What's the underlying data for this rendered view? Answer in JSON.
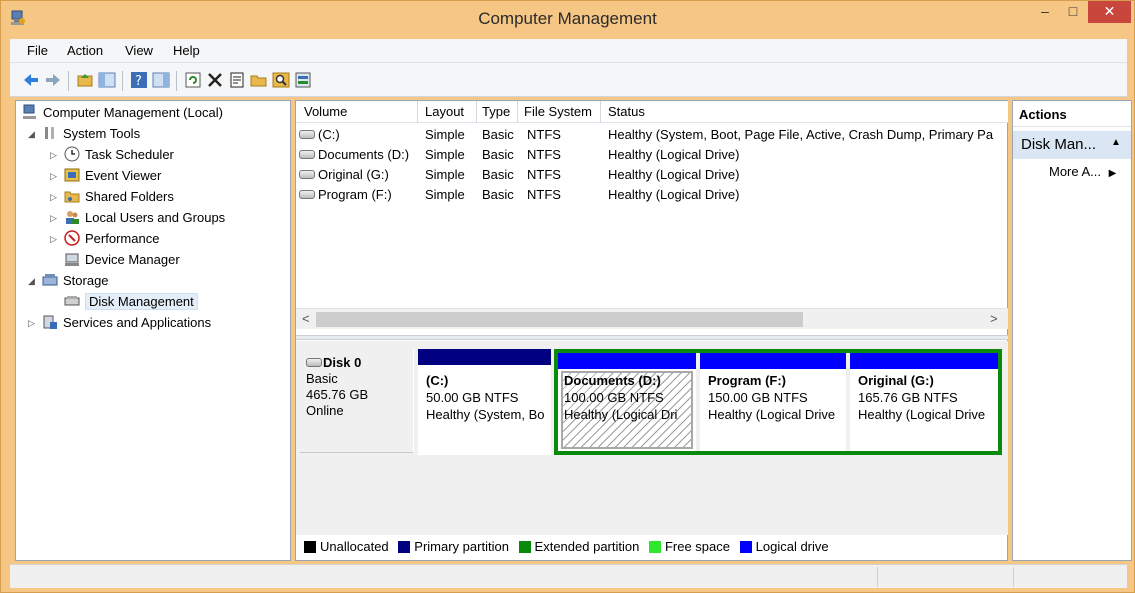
{
  "window": {
    "title": "Computer Management",
    "close_glyph": "✕",
    "min_glyph": "–",
    "max_glyph": "□"
  },
  "menu": [
    "File",
    "Action",
    "View",
    "Help"
  ],
  "tree": {
    "root": "Computer Management (Local)",
    "system_tools": "System Tools",
    "task_scheduler": "Task Scheduler",
    "event_viewer": "Event Viewer",
    "shared_folders": "Shared Folders",
    "local_users": "Local Users and Groups",
    "performance": "Performance",
    "device_manager": "Device Manager",
    "storage": "Storage",
    "disk_management": "Disk Management",
    "services": "Services and Applications"
  },
  "volume_list": {
    "headers": [
      "Volume",
      "Layout",
      "Type",
      "File System",
      "Status"
    ],
    "rows": [
      {
        "volume": "(C:)",
        "layout": "Simple",
        "type": "Basic",
        "fs": "NTFS",
        "status": "Healthy (System, Boot, Page File, Active, Crash Dump, Primary Pa"
      },
      {
        "volume": "Documents (D:)",
        "layout": "Simple",
        "type": "Basic",
        "fs": "NTFS",
        "status": "Healthy (Logical Drive)"
      },
      {
        "volume": "Original (G:)",
        "layout": "Simple",
        "type": "Basic",
        "fs": "NTFS",
        "status": "Healthy (Logical Drive)"
      },
      {
        "volume": "Program (F:)",
        "layout": "Simple",
        "type": "Basic",
        "fs": "NTFS",
        "status": "Healthy (Logical Drive)"
      }
    ]
  },
  "disk": {
    "name": "Disk 0",
    "type": "Basic",
    "size": "465.76 GB",
    "state": "Online",
    "partitions": [
      {
        "name": "(C:)",
        "size": "50.00 GB NTFS",
        "status": "Healthy (System, Bo"
      },
      {
        "name": "Documents  (D:)",
        "size": "100.00 GB NTFS",
        "status": "Healthy (Logical Dri"
      },
      {
        "name": "Program  (F:)",
        "size": "150.00 GB NTFS",
        "status": "Healthy (Logical Drive"
      },
      {
        "name": "Original  (G:)",
        "size": "165.76 GB NTFS",
        "status": "Healthy (Logical Drive"
      }
    ]
  },
  "legend": [
    "Unallocated",
    "Primary partition",
    "Extended partition",
    "Free space",
    "Logical drive"
  ],
  "colors": {
    "unallocated": "#000000",
    "primary": "#000080",
    "extended": "#0a8a0a",
    "free": "#2ee82e",
    "logical": "#0000ff"
  },
  "actions": {
    "header": "Actions",
    "section": "Disk Man...",
    "more": "More A..."
  },
  "scroll": {
    "left": "<",
    "right": ">"
  }
}
